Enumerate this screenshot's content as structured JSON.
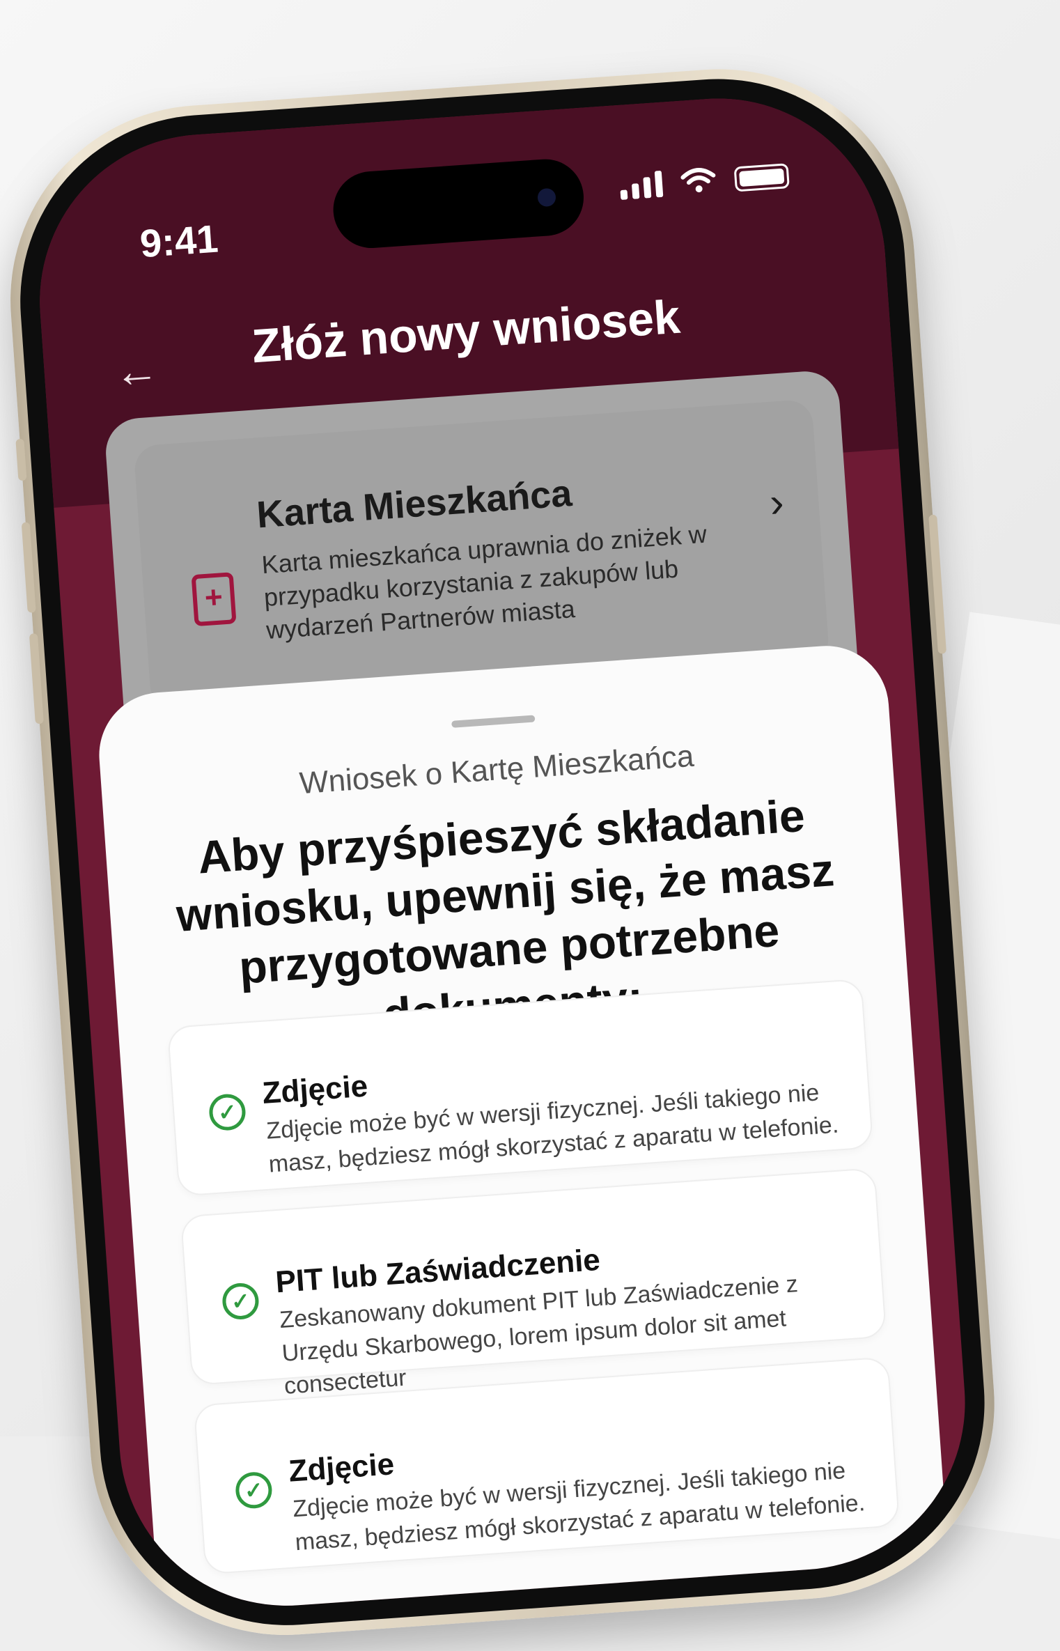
{
  "status_bar": {
    "time": "9:41"
  },
  "header": {
    "back_icon": "arrow-left-icon",
    "title": "Złóż nowy wniosek"
  },
  "card": {
    "icon": "file-plus-icon",
    "title": "Karta Mieszkańca",
    "description": "Karta mieszkańca uprawnia do zniżek w przypadku korzystania z zakupów lub wydarzeń Partnerów miasta",
    "chevron": "›"
  },
  "sheet": {
    "subtitle": "Wniosek o Kartę Mieszkańca",
    "title": "Aby przyśpieszyć składanie wniosku, upewnij się, że masz przygotowane potrzebne dokumenty:",
    "documents": [
      {
        "title": "Zdjęcie",
        "description": "Zdjęcie może być w wersji fizycznej. Jeśli takiego nie masz, będziesz mógł skorzystać z aparatu w telefonie."
      },
      {
        "title": "PIT lub Zaświadczenie",
        "description": "Zeskanowany dokument PIT lub Zaświadczenie  z Urzędu Skarbowego, lorem ipsum dolor sit amet consectetur"
      },
      {
        "title": "Zdjęcie",
        "description": "Zdjęcie może być w wersji fizycznej. Jeśli takiego nie masz, będziesz mógł skorzystać z aparatu w telefonie."
      }
    ]
  },
  "colors": {
    "header": "#4a0f24",
    "accent": "#a0153e",
    "check": "#2f9a3f"
  }
}
